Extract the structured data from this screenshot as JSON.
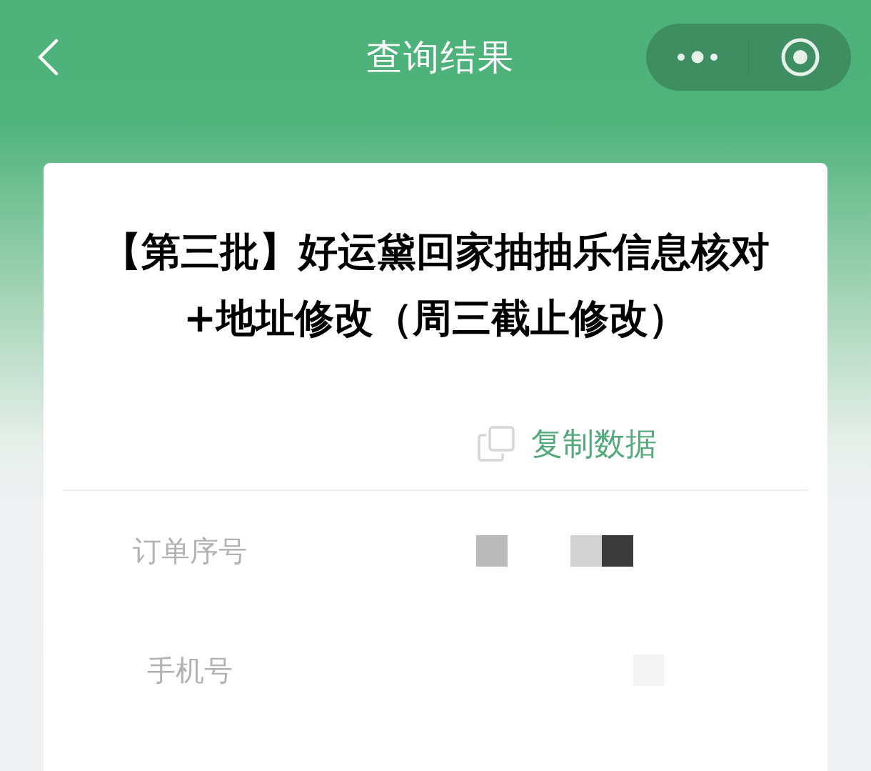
{
  "nav_bar": {
    "title": "查询结果"
  },
  "card": {
    "title": "【第三批】好运黛回家抽抽乐信息核对+地址修改（周三截止修改）",
    "copy_button": {
      "label": "复制数据"
    },
    "fields": [
      {
        "label": "订单序号",
        "mosaic": [
          {
            "kind": "tile",
            "color": "#bbbbbb"
          },
          {
            "kind": "blank"
          },
          {
            "kind": "blank"
          },
          {
            "kind": "tile",
            "color": "#d2d2d2"
          },
          {
            "kind": "tile",
            "color": "#3b3b3b"
          }
        ]
      },
      {
        "label": "手机号",
        "mosaic": [
          {
            "kind": "blank"
          },
          {
            "kind": "blank"
          },
          {
            "kind": "blank"
          },
          {
            "kind": "blank"
          },
          {
            "kind": "blank"
          },
          {
            "kind": "tile",
            "color": "#f4f4f4"
          }
        ]
      }
    ]
  }
}
